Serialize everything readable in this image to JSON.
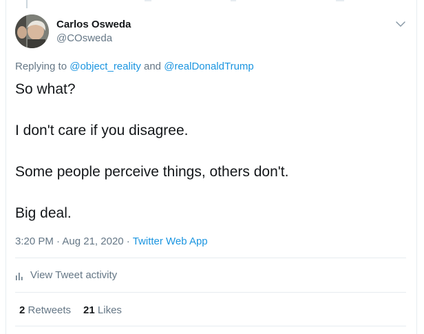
{
  "author": {
    "name": "Carlos Osweda",
    "handle": "@COsweda"
  },
  "reply": {
    "prefix": "Replying to ",
    "user1": "@object_reality",
    "conjunction": " and ",
    "user2": "@realDonaldTrump"
  },
  "tweet": {
    "lines": [
      "So what?",
      "I don't care if you disagree.",
      "Some people perceive things, others don't.",
      "Big deal."
    ]
  },
  "meta": {
    "time": "3:20 PM",
    "separator": " · ",
    "date": "Aug 21, 2020",
    "source": "Twitter Web App"
  },
  "activity": {
    "label": "View Tweet activity"
  },
  "stats": {
    "retweets_count": "2",
    "retweets_label": "Retweets",
    "likes_count": "21",
    "likes_label": "Likes"
  },
  "colors": {
    "link": "#1b95e0",
    "secondary": "#657786",
    "text": "#14171a",
    "divider": "#e6ecf0"
  }
}
